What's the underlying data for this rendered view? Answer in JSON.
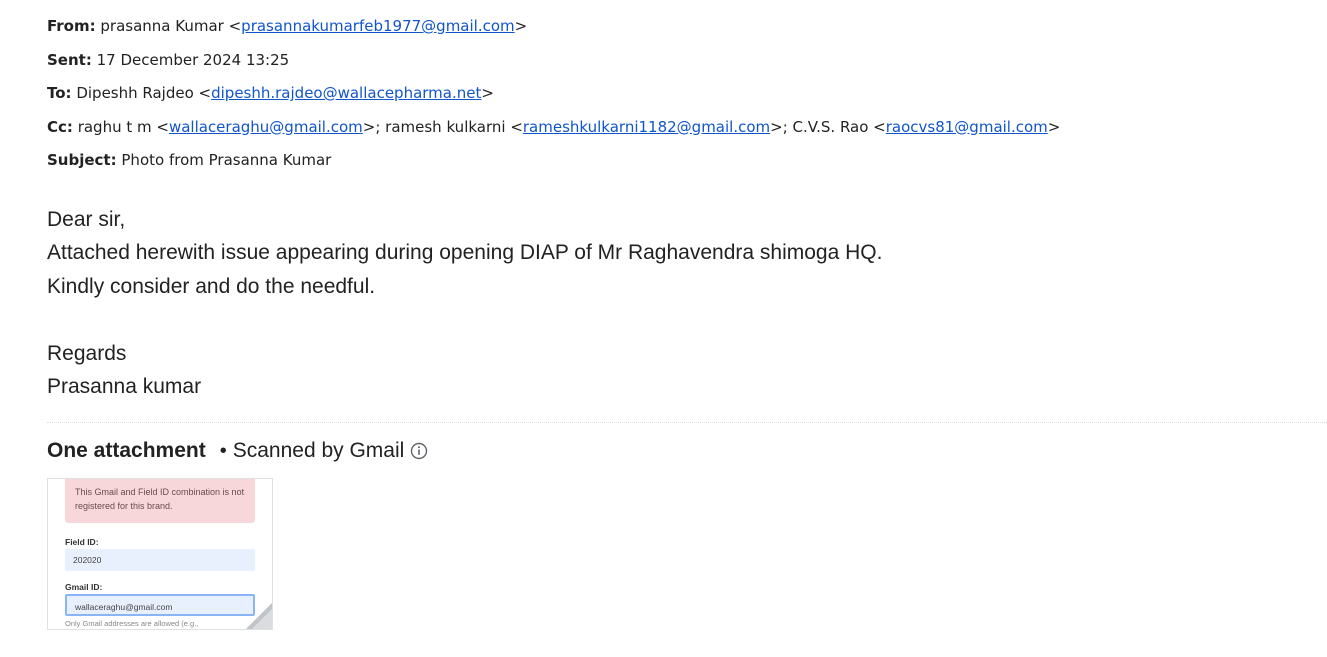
{
  "headers": {
    "from": {
      "label": "From:",
      "name": "prasanna Kumar <",
      "email": "prasannakumarfeb1977@gmail.com",
      "close": ">"
    },
    "sent": {
      "label": "Sent:",
      "value": "17 December 2024 13:25"
    },
    "to": {
      "label": "To:",
      "name": "Dipeshh Rajdeo <",
      "email": "dipeshh.rajdeo@wallacepharma.net",
      "close": ">"
    },
    "cc": {
      "label": "Cc:",
      "recipients": [
        {
          "prefix": "raghu t m <",
          "email": "wallaceraghu@gmail.com",
          "suffix": ">; "
        },
        {
          "prefix": "ramesh kulkarni <",
          "email": "rameshkulkarni1182@gmail.com",
          "suffix": ">; "
        },
        {
          "prefix": "C.V.S. Rao <",
          "email": "raocvs81@gmail.com",
          "suffix": ">"
        }
      ]
    },
    "subject": {
      "label": "Subject:",
      "value": "Photo from Prasanna Kumar"
    }
  },
  "body": {
    "lines": [
      "Dear sir,",
      "Attached herewith issue appearing during opening DIAP of Mr Raghavendra shimoga HQ.",
      "Kindly consider and do the needful.",
      "",
      "Regards",
      "Prasanna kumar"
    ]
  },
  "attachments": {
    "title": "One attachment",
    "separator": "•",
    "scanned_text": "Scanned by Gmail",
    "info_icon": "info-icon",
    "thumbnail": {
      "error_text": "This Gmail and Field ID combination is not registered for this brand.",
      "field_id_label": "Field ID:",
      "field_id_value": "202020",
      "gmail_id_label": "Gmail ID:",
      "gmail_id_value": "wallaceraghu@gmail.com",
      "hint_text": "Only Gmail addresses are allowed (e.g.,"
    }
  },
  "colors": {
    "link": "#1155cc",
    "text": "#222222",
    "error_bg": "#f8d7da",
    "field_bg": "#e8f0fe"
  }
}
